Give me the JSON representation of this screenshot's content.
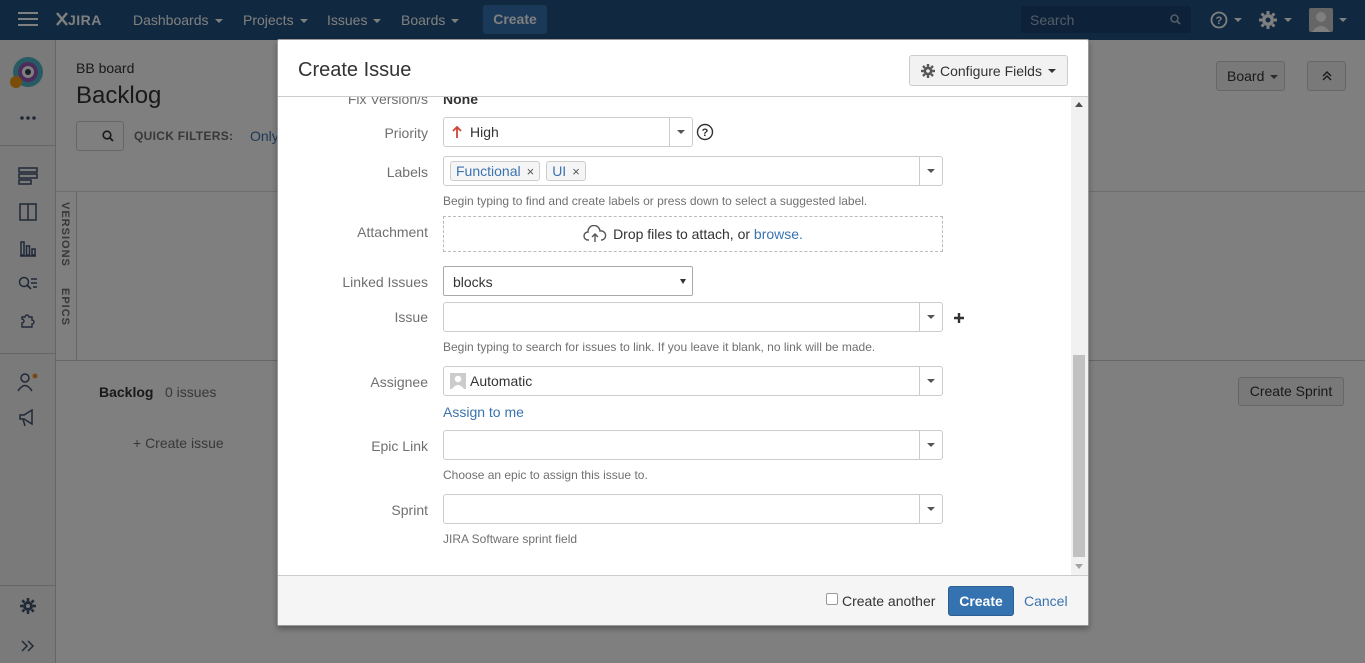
{
  "nav": {
    "logo": "JIRA",
    "menu": [
      {
        "label": "Dashboards"
      },
      {
        "label": "Projects"
      },
      {
        "label": "Issues"
      },
      {
        "label": "Boards"
      }
    ],
    "create_label": "Create",
    "search_placeholder": "Search"
  },
  "page": {
    "breadcrumb": "BB board",
    "title": "Backlog",
    "quick_filters_label": "QUICK FILTERS:",
    "quick_filter_only": "Only",
    "board_button": "Board",
    "versions_tab": "VERSIONS",
    "epics_tab": "EPICS",
    "backlog_title": "Backlog",
    "backlog_count": "0 issues",
    "create_sprint": "Create Sprint",
    "create_issue": "+  Create issue"
  },
  "dialog": {
    "title": "Create Issue",
    "configure_fields": "Configure Fields",
    "fix_version_label": "Fix Version/s",
    "fix_version_value": "None",
    "priority_label": "Priority",
    "priority_value": "High",
    "labels_label": "Labels",
    "labels": [
      "Functional",
      "UI"
    ],
    "labels_desc": "Begin typing to find and create labels or press down to select a suggested label.",
    "attachment_label": "Attachment",
    "attachment_text": "Drop files to attach, or",
    "attachment_browse": "browse.",
    "linked_issues_label": "Linked Issues",
    "linked_issues_value": "blocks",
    "issue_label": "Issue",
    "issue_desc": "Begin typing to search for issues to link. If you leave it blank, no link will be made.",
    "assignee_label": "Assignee",
    "assignee_value": "Automatic",
    "assign_to_me": "Assign to me",
    "epic_link_label": "Epic Link",
    "epic_link_desc": "Choose an epic to assign this issue to.",
    "sprint_label": "Sprint",
    "sprint_desc": "JIRA Software sprint field",
    "create_another": "Create another",
    "create_button": "Create",
    "cancel": "Cancel"
  },
  "colors": {
    "nav_bg": "#205081",
    "primary": "#3572b0",
    "link": "#3b73af",
    "priority_high": "#d04437"
  }
}
